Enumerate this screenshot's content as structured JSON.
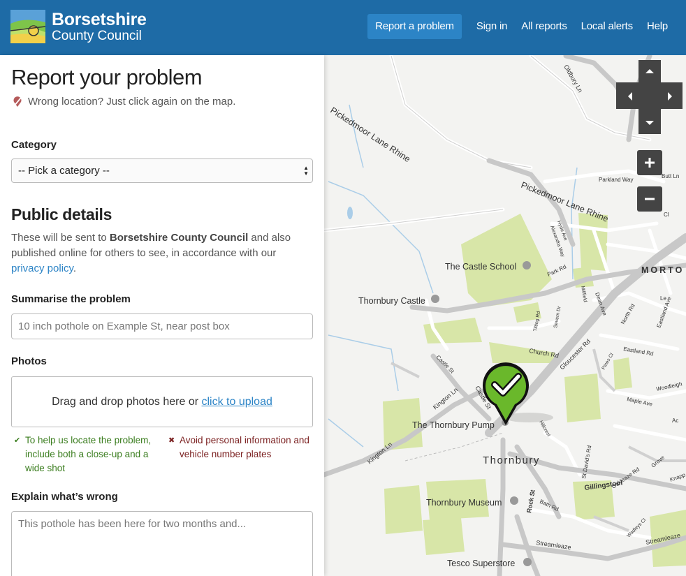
{
  "header": {
    "logo_line1": "Borsetshire",
    "logo_line2": "County Council",
    "nav": [
      "Report a problem",
      "Sign in",
      "All reports",
      "Local alerts",
      "Help"
    ]
  },
  "sidebar": {
    "title": "Report your problem",
    "wrong_location": "Wrong location? Just click again on the map.",
    "category_label": "Category",
    "category_select": "-- Pick a category --",
    "public_heading": "Public details",
    "public_text_1": "These will be sent to ",
    "public_council": "Borsetshire County Council",
    "public_text_2": " and also published online for others to see, in accordance with our ",
    "privacy_link": "privacy policy",
    "public_text_3": ".",
    "summarise_label": "Summarise the problem",
    "summarise_placeholder": "10 inch pothole on Example St, near post box",
    "photos_label": "Photos",
    "dropzone_text": "Drag and drop photos here or ",
    "dropzone_link": "click to upload",
    "tip_good": "To help us locate the problem, include both a close-up and a wide shot",
    "tip_bad": "Avoid personal information and vehicle number plates",
    "explain_label": "Explain what’s wrong",
    "explain_placeholder": "This pothole has been here for two months and..."
  },
  "map": {
    "labels": {
      "oldbury": "Oldbury Ln",
      "pickedmoor1": "Pickedmoor Lane Rhine",
      "pickedmoor2": "Pickedmoor Lane Rhine",
      "parkland": "Parkland Way",
      "butt": "Butt Ln",
      "castle_school": "The Castle School",
      "morton": "MORTO",
      "thornbury_castle": "Thornbury Castle",
      "park_rd": "Park Rd",
      "church_rd": "Church Rd",
      "gloucester_rd": "Gloucester Rd",
      "eastland": "Eastland Rd",
      "castle_st": "Castle St",
      "castle_st2": "Castle St",
      "kington_ln": "Kington Ln",
      "kington_ln2": "Kington Ln",
      "pump": "The Thornbury Pump",
      "thornbury": "Thornbury",
      "maple": "Maple Ave",
      "woodleigh": "Woodleigh",
      "gillingstool": "Gillingstool",
      "museum": "Thornbury Museum",
      "st_davids": "St David's Rd",
      "rock_st": "Rock St",
      "bath_rd": "Bath Rd",
      "streamleaze": "Streamleaze",
      "streamleaze2": "Streamleaze",
      "tesco": "Tesco Superstore",
      "hillcrest": "Hillcrest",
      "oakleaze": "Oakleaze Rd",
      "dean": "Dean Ave",
      "north_rd": "North Rd",
      "eastland_ave": "Eastland Ave",
      "severn": "Severn Dr",
      "tilting": "Tilting Rd",
      "millfield": "Millfield",
      "hyde": "Hyde Ave",
      "alexandra": "Alexandra Way",
      "knapp": "Knapp",
      "pines": "Pines Cl",
      "wadleys": "Wadleys Cl",
      "grove": "Grove",
      "ac": "Ac",
      "cl": "Cl",
      "le": "Le"
    }
  },
  "colors": {
    "header": "#1e6ba6",
    "nav_active": "#2c84c6",
    "link": "#2c84c6",
    "good": "#3a7d1e",
    "bad": "#7a1f1f",
    "pin": "#6ab82b"
  }
}
